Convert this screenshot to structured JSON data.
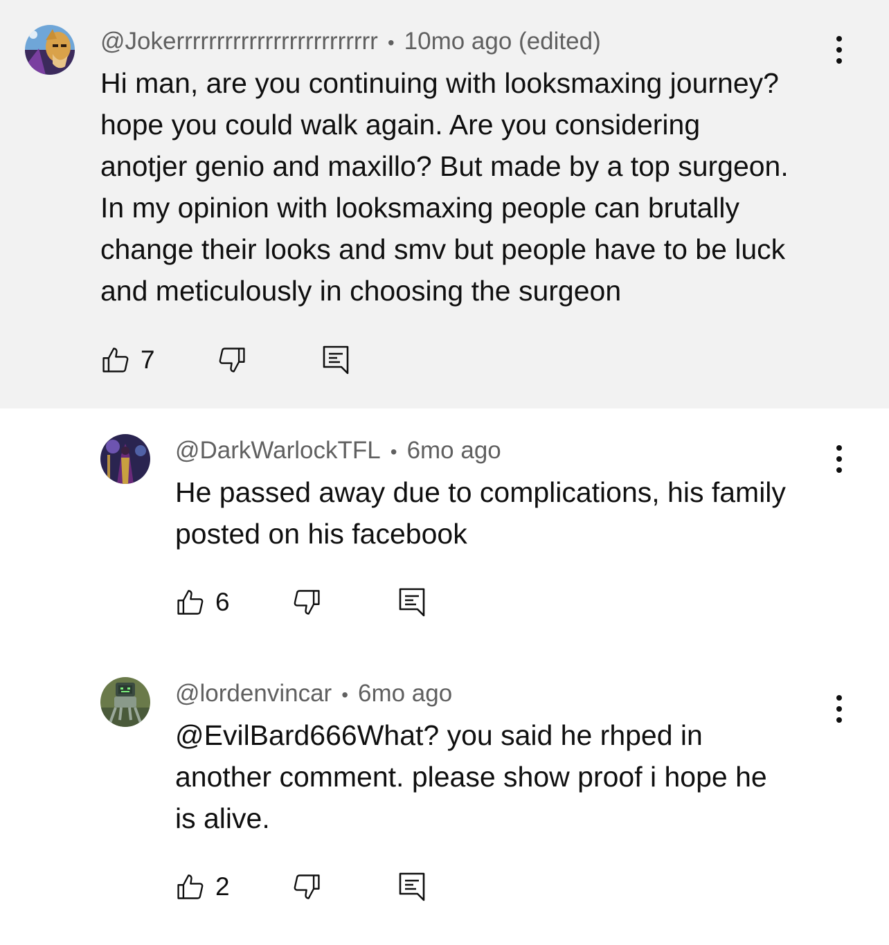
{
  "comments": [
    {
      "author": "@Jokerrrrrrrrrrrrrrrrrrrrrrrrr",
      "separator": "•",
      "time": "10mo ago (edited)",
      "lines": [
        "Hi man, are you continuing with looksmaxing journey?",
        "hope you could walk again. Are you considering",
        "anotjer genio and maxillo? But made by a top surgeon.",
        "In my opinion with looksmaxing people can brutally",
        "change their looks and smv but people have to be luck",
        "and meticulously in choosing the surgeon"
      ],
      "likes": "7",
      "avatar_icon": "wizard-avatar",
      "highlighted": true
    },
    {
      "author": "@DarkWarlockTFL",
      "separator": "•",
      "time": "6mo ago",
      "lines": [
        "He passed away due to complications, his family",
        "posted on his facebook"
      ],
      "likes": "6",
      "avatar_icon": "warlock-avatar",
      "highlighted": false
    },
    {
      "author": "@lordenvincar",
      "separator": "•",
      "time": "6mo ago",
      "lines": [
        "@EvilBard666What? you said he rhped in",
        "another comment. please show proof i hope he",
        "is alive."
      ],
      "likes": "2",
      "avatar_icon": "robot-avatar",
      "highlighted": false
    }
  ],
  "icons": {
    "like": "thumbs-up-icon",
    "dislike": "thumbs-down-icon",
    "reply": "reply-comment-icon",
    "menu": "more-vertical-icon"
  },
  "colors": {
    "highlight_bg": "#f2f2f2",
    "meta_text": "#606060",
    "body_text": "#0f0f0f"
  }
}
